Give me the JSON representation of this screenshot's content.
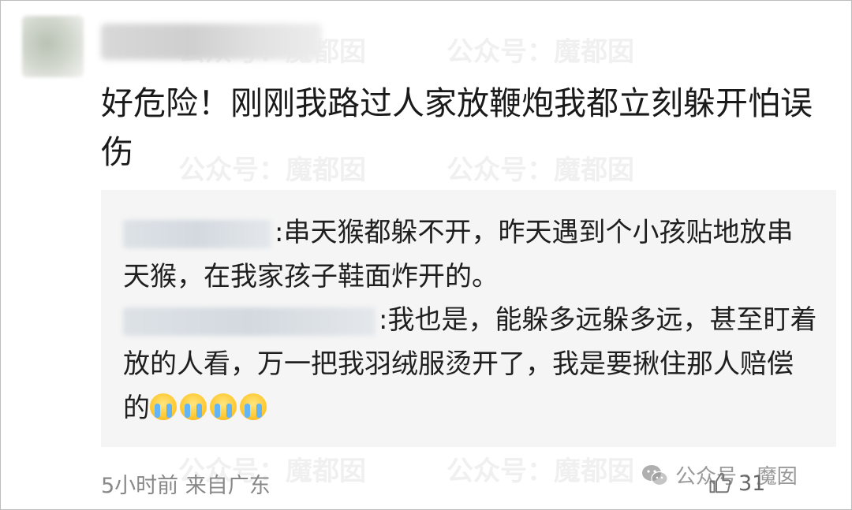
{
  "comment": {
    "text": "好危险！刚刚我路过人家放鞭炮我都立刻躲开怕误伤"
  },
  "replies": [
    {
      "text": ":串天猴都躲不开，昨天遇到个小孩贴地放串天猴，在我家孩子鞋面炸开的。"
    },
    {
      "text": ":我也是，能躲多远躲多远，甚至盯着放的人看，万一把我羽绒服烫开了，我是要揪住那人赔偿的",
      "emoji_count": 4
    }
  ],
  "footer": {
    "time_location": "5小时前 来自广东",
    "like_count": "31"
  },
  "watermark": {
    "text": "公众号：魔都囡",
    "corner_text": "公众号 · 魔囡"
  },
  "icons": {
    "like": "thumbs-up-icon",
    "wechat": "wechat-icon",
    "emoji": "crying-face-emoji"
  }
}
